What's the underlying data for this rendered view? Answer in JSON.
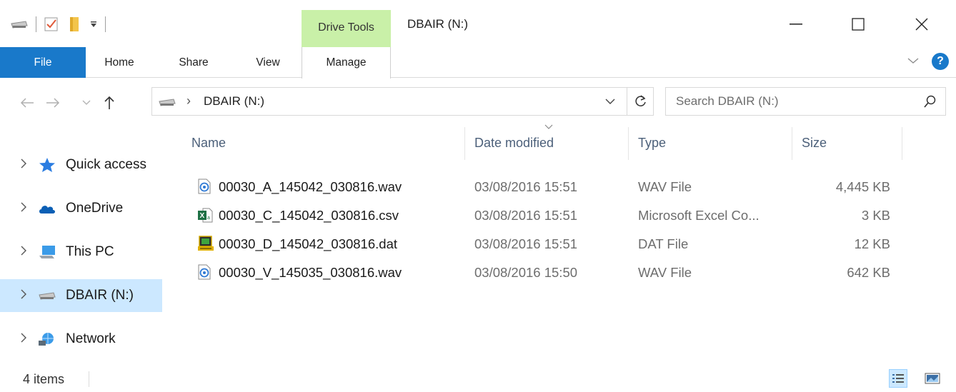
{
  "window": {
    "title": "DBAIR (N:)",
    "contextual_tab_group": "Drive Tools"
  },
  "ribbon": {
    "tabs": [
      {
        "label": "File"
      },
      {
        "label": "Home"
      },
      {
        "label": "Share"
      },
      {
        "label": "View"
      },
      {
        "label": "Manage"
      }
    ]
  },
  "address_bar": {
    "path": "DBAIR (N:)"
  },
  "search": {
    "placeholder": "Search DBAIR (N:)"
  },
  "sidebar": {
    "items": [
      {
        "label": "Quick access",
        "icon": "star-icon"
      },
      {
        "label": "OneDrive",
        "icon": "cloud-icon"
      },
      {
        "label": "This PC",
        "icon": "computer-icon"
      },
      {
        "label": "DBAIR (N:)",
        "icon": "drive-icon",
        "selected": true
      },
      {
        "label": "Network",
        "icon": "network-icon"
      }
    ]
  },
  "file_list": {
    "columns": [
      "Name",
      "Date modified",
      "Type",
      "Size"
    ],
    "rows": [
      {
        "name": "00030_A_145042_030816.wav",
        "date": "03/08/2016 15:51",
        "type": "WAV File",
        "size": "4,445 KB",
        "icon": "audio-file-icon"
      },
      {
        "name": "00030_C_145042_030816.csv",
        "date": "03/08/2016 15:51",
        "type": "Microsoft Excel Co...",
        "size": "3 KB",
        "icon": "excel-file-icon"
      },
      {
        "name": "00030_D_145042_030816.dat",
        "date": "03/08/2016 15:51",
        "type": "DAT File",
        "size": "12 KB",
        "icon": "dat-file-icon"
      },
      {
        "name": "00030_V_145035_030816.wav",
        "date": "03/08/2016 15:50",
        "type": "WAV File",
        "size": "642 KB",
        "icon": "audio-file-icon"
      }
    ]
  },
  "status_bar": {
    "item_count": "4 items"
  },
  "colors": {
    "accent": "#1979ca",
    "drive_tools_bg": "#c9f0a8",
    "selection_bg": "#cce8ff"
  }
}
